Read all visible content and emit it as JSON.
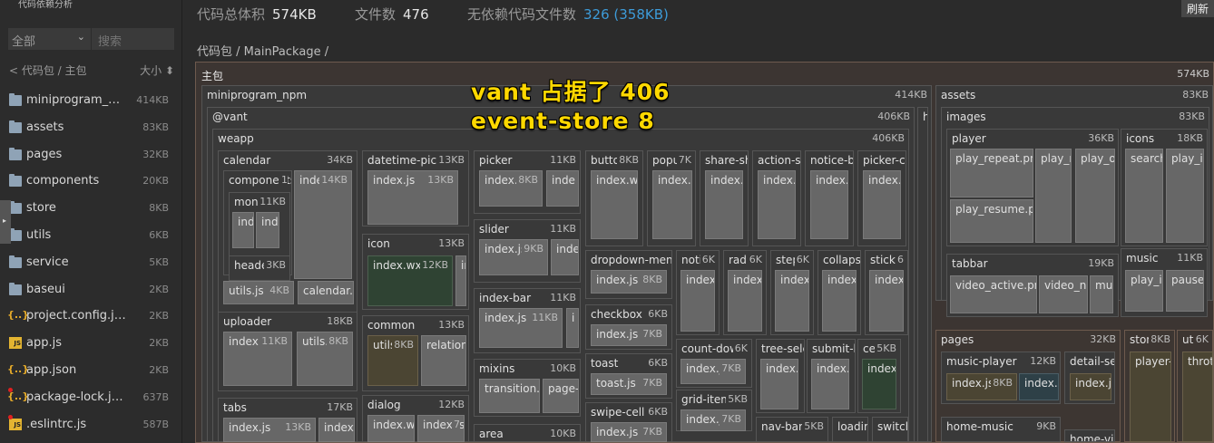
{
  "sidebar": {
    "title": "代码依赖分析",
    "filter_value": "全部",
    "search_placeholder": "搜索",
    "breadcrumb": "< 代码包 / 主包",
    "sort_label": "大小 ⬍",
    "items": [
      {
        "name": "miniprogram_np...",
        "size": "414KB",
        "icon": "folder-icon",
        "dot": false
      },
      {
        "name": "assets",
        "size": "83KB",
        "icon": "folder-icon",
        "dot": false
      },
      {
        "name": "pages",
        "size": "32KB",
        "icon": "folder-icon",
        "dot": false
      },
      {
        "name": "components",
        "size": "20KB",
        "icon": "folder-icon",
        "dot": false
      },
      {
        "name": "store",
        "size": "8KB",
        "icon": "folder-icon",
        "dot": false
      },
      {
        "name": "utils",
        "size": "6KB",
        "icon": "folder-icon",
        "dot": false
      },
      {
        "name": "service",
        "size": "5KB",
        "icon": "folder-icon",
        "dot": false
      },
      {
        "name": "baseui",
        "size": "2KB",
        "icon": "folder-icon",
        "dot": false
      },
      {
        "name": "project.config.json",
        "size": "2KB",
        "icon": "json-icon",
        "dot": false
      },
      {
        "name": "app.js",
        "size": "2KB",
        "icon": "js-icon",
        "dot": false
      },
      {
        "name": "app.json",
        "size": "2KB",
        "icon": "json-icon",
        "dot": false
      },
      {
        "name": "package-lock.json",
        "size": "637B",
        "icon": "json-icon",
        "dot": true
      },
      {
        "name": ".eslintrc.js",
        "size": "587B",
        "icon": "js-icon",
        "dot": true
      }
    ]
  },
  "stats": {
    "total_label": "代码总体积",
    "total_value": "574KB",
    "files_label": "文件数",
    "files_value": "476",
    "nodep_label": "无依赖代码文件数",
    "nodep_value": "326 (358KB)"
  },
  "toolbar": {
    "refresh_label": "刷新"
  },
  "breadcrumb": "代码包 / MainPackage /",
  "overlay": {
    "line1": "vant 占据了 406",
    "line2": "event-store 8"
  },
  "treemap": [
    {
      "label": "主包",
      "size": "574KB"
    },
    {
      "label": "miniprogram_npm",
      "size": "414KB"
    },
    {
      "label": "@vant",
      "size": "406KB"
    },
    {
      "label": "weapp",
      "size": "406KB"
    },
    {
      "label": "calendar",
      "size": "34KB"
    },
    {
      "label": "components",
      "size": "1"
    },
    {
      "label": "month",
      "size": "11KB"
    },
    {
      "label": "index",
      "size": ""
    },
    {
      "label": "ind",
      "size": ""
    },
    {
      "label": "header",
      "size": "3KB"
    },
    {
      "label": "index.js",
      "size": "14KB"
    },
    {
      "label": "utils.js",
      "size": "4KB"
    },
    {
      "label": "calendar.w",
      "size": ""
    },
    {
      "label": "uploader",
      "size": "18KB"
    },
    {
      "label": "index.js",
      "size": "11KB"
    },
    {
      "label": "utils.js",
      "size": "8KB"
    },
    {
      "label": "tabs",
      "size": "17KB"
    },
    {
      "label": "index.js",
      "size": "13KB"
    },
    {
      "label": "index.w",
      "size": ""
    },
    {
      "label": "datetime-picker",
      "size": "13KB"
    },
    {
      "label": "index.js",
      "size": "13KB"
    },
    {
      "label": "icon",
      "size": "13KB"
    },
    {
      "label": "index.wxss",
      "size": "12KB"
    },
    {
      "label": "in",
      "size": ""
    },
    {
      "label": "common",
      "size": "13KB"
    },
    {
      "label": "utils.js",
      "size": "8KB"
    },
    {
      "label": "relation.",
      "size": ""
    },
    {
      "label": "dialog",
      "size": "12KB"
    },
    {
      "label": "index.wxs",
      "size": ""
    },
    {
      "label": "index.js",
      "size": "7"
    },
    {
      "label": "picker",
      "size": "11KB"
    },
    {
      "label": "index.js",
      "size": "8KB"
    },
    {
      "label": "inde",
      "size": ""
    },
    {
      "label": "slider",
      "size": "11KB"
    },
    {
      "label": "index.js",
      "size": "9KB"
    },
    {
      "label": "inde",
      "size": ""
    },
    {
      "label": "index-bar",
      "size": "11KB"
    },
    {
      "label": "index.js",
      "size": "11KB"
    },
    {
      "label": "i",
      "size": ""
    },
    {
      "label": "mixins",
      "size": "10KB"
    },
    {
      "label": "transition.js",
      "size": ""
    },
    {
      "label": "page-",
      "size": ""
    },
    {
      "label": "area",
      "size": "10KB"
    },
    {
      "label": "button",
      "size": "8KB"
    },
    {
      "label": "index.wxs",
      "size": ""
    },
    {
      "label": "popup",
      "size": "7K"
    },
    {
      "label": "index.w",
      "size": ""
    },
    {
      "label": "share-she",
      "size": ""
    },
    {
      "label": "index.js",
      "size": ""
    },
    {
      "label": "action-sh",
      "size": ""
    },
    {
      "label": "index.w",
      "size": ""
    },
    {
      "label": "notice-ba",
      "size": ""
    },
    {
      "label": "index.js",
      "size": ""
    },
    {
      "label": "picker-co",
      "size": ""
    },
    {
      "label": "index.j",
      "size": ""
    },
    {
      "label": "dropdown-menu",
      "size": ""
    },
    {
      "label": "index.js",
      "size": "8KB"
    },
    {
      "label": "checkbox",
      "size": "6KB"
    },
    {
      "label": "index.js",
      "size": "7KB"
    },
    {
      "label": "toast",
      "size": "6KB"
    },
    {
      "label": "toast.js",
      "size": "7KB"
    },
    {
      "label": "swipe-cell",
      "size": "6KB"
    },
    {
      "label": "index.js",
      "size": "7KB"
    },
    {
      "label": "notify",
      "size": "6K"
    },
    {
      "label": "index.",
      "size": ""
    },
    {
      "label": "radio",
      "size": "6K"
    },
    {
      "label": "index.",
      "size": ""
    },
    {
      "label": "steps",
      "size": "6K"
    },
    {
      "label": "index.",
      "size": ""
    },
    {
      "label": "collapse",
      "size": ""
    },
    {
      "label": "index.",
      "size": ""
    },
    {
      "label": "sticky",
      "size": "6"
    },
    {
      "label": "index.",
      "size": ""
    },
    {
      "label": "count-down",
      "size": "6K"
    },
    {
      "label": "index.js",
      "size": "7KB"
    },
    {
      "label": "tree-sele",
      "size": ""
    },
    {
      "label": "index.js",
      "size": ""
    },
    {
      "label": "submit-b",
      "size": ""
    },
    {
      "label": "index.w",
      "size": ""
    },
    {
      "label": "cell",
      "size": "5KB"
    },
    {
      "label": "index.w",
      "size": ""
    },
    {
      "label": "grid-item",
      "size": "5KB"
    },
    {
      "label": "index.js",
      "size": "7KB"
    },
    {
      "label": "nav-bar",
      "size": "5KB"
    },
    {
      "label": "loadir",
      "size": ""
    },
    {
      "label": "switch",
      "size": ""
    },
    {
      "label": "h",
      "size": ""
    },
    {
      "label": "assets",
      "size": "83KB"
    },
    {
      "label": "images",
      "size": "83KB"
    },
    {
      "label": "player",
      "size": "36KB"
    },
    {
      "label": "play_repeat.png",
      "size": ""
    },
    {
      "label": "play_ra",
      "size": ""
    },
    {
      "label": "play_or",
      "size": ""
    },
    {
      "label": "play_resume.png",
      "size": ""
    },
    {
      "label": "icons",
      "size": "18KB"
    },
    {
      "label": "search_",
      "size": ""
    },
    {
      "label": "play_ic",
      "size": ""
    },
    {
      "label": "tabbar",
      "size": "19KB"
    },
    {
      "label": "video_active.png",
      "size": ""
    },
    {
      "label": "video_no",
      "size": ""
    },
    {
      "label": "mus",
      "size": ""
    },
    {
      "label": "music",
      "size": "11KB"
    },
    {
      "label": "play_ic",
      "size": ""
    },
    {
      "label": "pause_",
      "size": ""
    },
    {
      "label": "pages",
      "size": "32KB"
    },
    {
      "label": "music-player",
      "size": "12KB"
    },
    {
      "label": "index.js",
      "size": "8KB"
    },
    {
      "label": "index.w",
      "size": ""
    },
    {
      "label": "detail-sea",
      "size": ""
    },
    {
      "label": "index.js",
      "size": ""
    },
    {
      "label": "home-music",
      "size": "9KB"
    },
    {
      "label": "home-vid",
      "size": ""
    },
    {
      "label": "store",
      "size": "8KB"
    },
    {
      "label": "player-s",
      "size": ""
    },
    {
      "label": "utils",
      "size": "6K"
    },
    {
      "label": "throt",
      "size": ""
    }
  ]
}
